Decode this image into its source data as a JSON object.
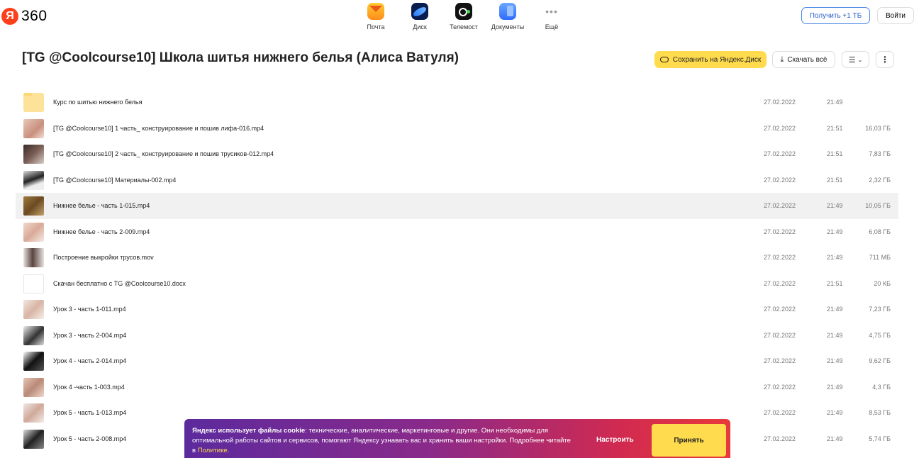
{
  "header": {
    "logo_letter": "Я",
    "logo_text": "360",
    "apps": [
      {
        "label": "Почта",
        "icon": "mail-icon"
      },
      {
        "label": "Диск",
        "icon": "disk-icon"
      },
      {
        "label": "Телемост",
        "icon": "telemost-icon"
      },
      {
        "label": "Документы",
        "icon": "documents-icon"
      },
      {
        "label": "Ещё",
        "icon": "more-apps-icon"
      }
    ],
    "get_tb_label": "Получить +1 ТБ",
    "login_label": "Войти"
  },
  "toolbar": {
    "title": "[TG @Coolcourse10] Школа шитья нижнего белья (Алиса Ватуля)",
    "save_label": "Сохранить на Яндекс.Диск",
    "download_all_label": "Скачать всё"
  },
  "files": [
    {
      "name": "Курс по шитью нижнего белья",
      "date": "27.02.2022",
      "time": "21:49",
      "size": "",
      "type": "folder"
    },
    {
      "name": "[TG @Coolcourse10] 1 часть_ конструирование и пошив лифа-016.mp4",
      "date": "27.02.2022",
      "time": "21:51",
      "size": "16,03 ГБ",
      "type": "video",
      "thumb": "linear-gradient(135deg,#e8c8b8,#c98f7e 60%,#f3e0d6)"
    },
    {
      "name": "[TG @Coolcourse10] 2 часть_ конструирование и пошив трусиков-012.mp4",
      "date": "27.02.2022",
      "time": "21:51",
      "size": "7,83 ГБ",
      "type": "video",
      "thumb": "linear-gradient(135deg,#3a2a28,#7a5e55 50%,#d8cfc8)"
    },
    {
      "name": "[TG @Coolcourse10] Материалы-002.mp4",
      "date": "27.02.2022",
      "time": "21:51",
      "size": "2,32 ГБ",
      "type": "video",
      "thumb": "linear-gradient(160deg,#ddd 0%,#222 45%,#eee 70%)"
    },
    {
      "name": "Нижнее белье - часть 1-015.mp4",
      "date": "27.02.2022",
      "time": "21:49",
      "size": "10,05 ГБ",
      "type": "video",
      "thumb": "linear-gradient(135deg,#a07a3e,#6b4a22 50%,#c2a36a)"
    },
    {
      "name": "Нижнее белье - часть 2-009.mp4",
      "date": "27.02.2022",
      "time": "21:49",
      "size": "6,08 ГБ",
      "type": "video",
      "thumb": "linear-gradient(135deg,#f0d8cc,#d9aa98 50%,#f6ebe4)"
    },
    {
      "name": "Построение выкройки трусов.mov",
      "date": "27.02.2022",
      "time": "21:49",
      "size": "711 МБ",
      "type": "video",
      "thumb": "linear-gradient(90deg,#e7e2de,#5a4440 45%,#e7e2de)"
    },
    {
      "name": "Скачан бесплатно с TG @Coolcourse10.docx",
      "date": "27.02.2022",
      "time": "21:51",
      "size": "20 КБ",
      "type": "doc"
    },
    {
      "name": "Урок 3 - часть 1-011.mp4",
      "date": "27.02.2022",
      "time": "21:49",
      "size": "7,23 ГБ",
      "type": "video",
      "thumb": "linear-gradient(135deg,#f3e6e0,#d8b5a6 50%,#f6eee9)"
    },
    {
      "name": "Урок 3 - часть 2-004.mp4",
      "date": "27.02.2022",
      "time": "21:49",
      "size": "4,75 ГБ",
      "type": "video",
      "thumb": "linear-gradient(135deg,#eee,#333 55%,#ddd)"
    },
    {
      "name": "Урок 4 - часть 2-014.mp4",
      "date": "27.02.2022",
      "time": "21:49",
      "size": "9,62 ГБ",
      "type": "video",
      "thumb": "linear-gradient(135deg,#fff,#111 50%,#555)"
    },
    {
      "name": "Урок 4 -часть 1-003.mp4",
      "date": "27.02.2022",
      "time": "21:49",
      "size": "4,3 ГБ",
      "type": "video",
      "thumb": "linear-gradient(135deg,#e6c4b4,#b98a78 50%,#efd7ca)"
    },
    {
      "name": "Урок 5 - часть 1-013.mp4",
      "date": "27.02.2022",
      "time": "21:49",
      "size": "8,53 ГБ",
      "type": "video",
      "thumb": "linear-gradient(135deg,#f0e6e2,#cfa99a 50%,#f4ece8)"
    },
    {
      "name": "Урок 5 - часть 2-008.mp4",
      "date": "27.02.2022",
      "time": "21:49",
      "size": "5,74 ГБ",
      "type": "video",
      "thumb": "linear-gradient(135deg,#ddd,#222 50%,#888)"
    }
  ],
  "selected_index": 4,
  "cookie": {
    "bold": "Яндекс использует файлы cookie",
    "text": ": технические, аналитические, маркетинговые и другие. Они необходимы для оптимальной работы сайтов и сервисов, помогают Яндексу узнавать вас и хранить ваши настройки. Подробнее читайте в ",
    "link": "Политике",
    "end": ".",
    "setup_label": "Настроить",
    "accept_label": "Принять"
  }
}
